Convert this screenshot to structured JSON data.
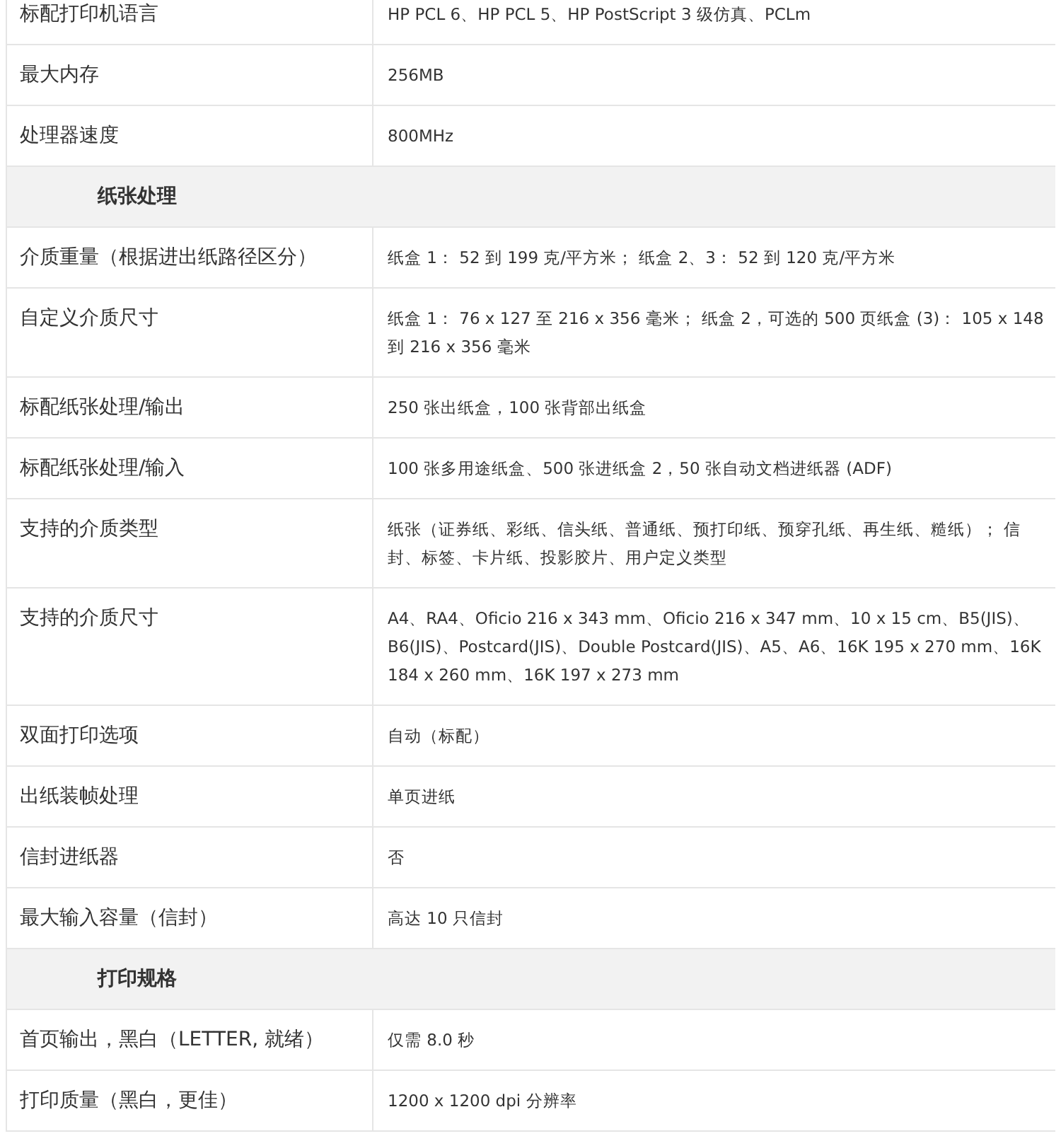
{
  "rows": [
    {
      "kind": "spec",
      "label": "标配打印机语言",
      "value": "HP PCL 6、HP PCL 5、HP PostScript 3 级仿真、PCLm"
    },
    {
      "kind": "spec",
      "label": "最大内存",
      "value": "256MB"
    },
    {
      "kind": "spec",
      "label": "处理器速度",
      "value": "800MHz"
    },
    {
      "kind": "section",
      "label": "纸张处理"
    },
    {
      "kind": "spec",
      "label": "介质重量（根据进出纸路径区分）",
      "value": "纸盒 1： 52 到 199 克/平方米； 纸盒 2、3： 52 到 120 克/平方米"
    },
    {
      "kind": "spec",
      "label": "自定义介质尺寸",
      "value": "纸盒 1： 76 x 127 至 216 x 356 毫米； 纸盒 2，可选的 500 页纸盒 (3)： 105 x 148 到 216 x 356 毫米"
    },
    {
      "kind": "spec",
      "label": "标配纸张处理/输出",
      "value": "250 张出纸盒，100 张背部出纸盒"
    },
    {
      "kind": "spec",
      "label": "标配纸张处理/输入",
      "value": "100 张多用途纸盒、500 张进纸盒 2，50 张自动文档进纸器 (ADF)"
    },
    {
      "kind": "spec",
      "label": "支持的介质类型",
      "value": "纸张（证券纸、彩纸、信头纸、普通纸、预打印纸、预穿孔纸、再生纸、糙纸）； 信封、标签、卡片纸、投影胶片、用户定义类型"
    },
    {
      "kind": "spec",
      "label": "支持的介质尺寸",
      "value": "A4、RA4、Oficio 216 x 343 mm、Oficio 216 x 347 mm、10 x 15 cm、B5(JIS)、B6(JIS)、Postcard(JIS)、Double Postcard(JIS)、A5、A6、16K 195 x 270 mm、16K 184 x 260 mm、16K 197 x 273 mm"
    },
    {
      "kind": "spec",
      "label": "双面打印选项",
      "value": "自动（标配）"
    },
    {
      "kind": "spec",
      "label": "出纸装帧处理",
      "value": "单页进纸"
    },
    {
      "kind": "spec",
      "label": "信封进纸器",
      "value": "否"
    },
    {
      "kind": "spec",
      "label": "最大输入容量（信封）",
      "value": "高达 10 只信封"
    },
    {
      "kind": "section",
      "label": "打印规格"
    },
    {
      "kind": "spec",
      "label": "首页输出，黑白（LETTER, 就绪）",
      "value": "仅需 8.0 秒"
    },
    {
      "kind": "spec",
      "label": "打印质量（黑白，更佳）",
      "value": "1200 x 1200 dpi 分辨率"
    }
  ]
}
